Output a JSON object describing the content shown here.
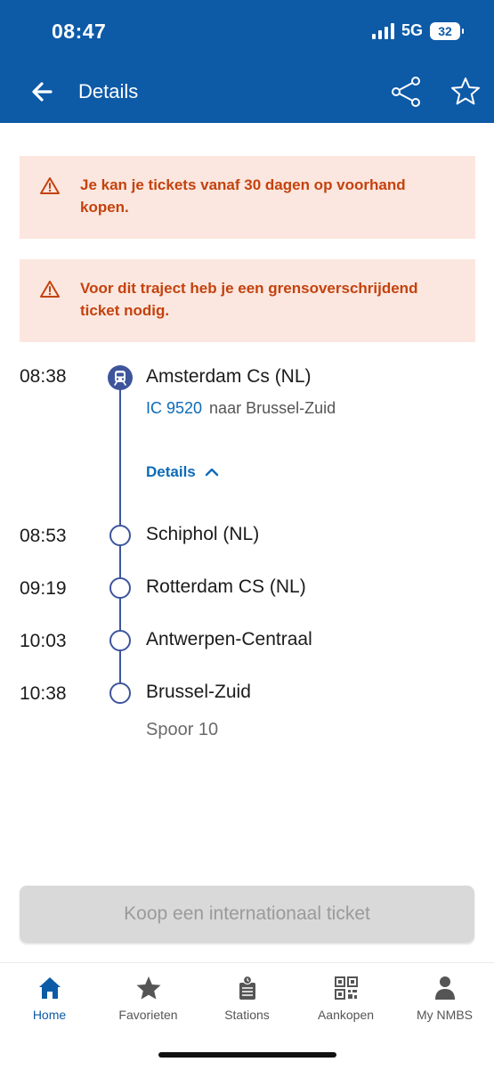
{
  "status": {
    "time": "08:47",
    "network": "5G",
    "battery": "32"
  },
  "header": {
    "title": "Details",
    "back_icon": "arrow-left-icon",
    "share_icon": "share-icon",
    "favorite_icon": "star-outline-icon"
  },
  "alerts": [
    {
      "icon": "warning-icon",
      "text": "Je kan je tickets vanaf 30 dagen op voorhand kopen."
    },
    {
      "icon": "warning-icon",
      "text": "Voor dit traject heb je een grensoverschrijdend ticket nodig."
    }
  ],
  "journey": {
    "departure": {
      "time": "08:38",
      "station": "Amsterdam Cs (NL)"
    },
    "train_number": "IC 9520",
    "direction": "naar Brussel-Zuid",
    "details_label": "Details",
    "stops": [
      {
        "time": "08:53",
        "station": "Schiphol (NL)"
      },
      {
        "time": "09:19",
        "station": "Rotterdam CS (NL)"
      },
      {
        "time": "10:03",
        "station": "Antwerpen-Centraal"
      },
      {
        "time": "10:38",
        "station": "Brussel-Zuid"
      }
    ],
    "platform": "Spoor 10"
  },
  "buy_button": {
    "label": "Koop een internationaal ticket"
  },
  "tabs": [
    {
      "label": "Home",
      "icon": "home-icon",
      "active": true
    },
    {
      "label": "Favorieten",
      "icon": "star-icon",
      "active": false
    },
    {
      "label": "Stations",
      "icon": "station-board-icon",
      "active": false
    },
    {
      "label": "Aankopen",
      "icon": "qr-code-icon",
      "active": false
    },
    {
      "label": "My NMBS",
      "icon": "person-icon",
      "active": false
    }
  ],
  "colors": {
    "brand": "#0d5aa7",
    "alert_bg": "#fbe7df",
    "alert_text": "#c4420e",
    "timeline": "#3e559c",
    "link": "#0d6bb8"
  }
}
